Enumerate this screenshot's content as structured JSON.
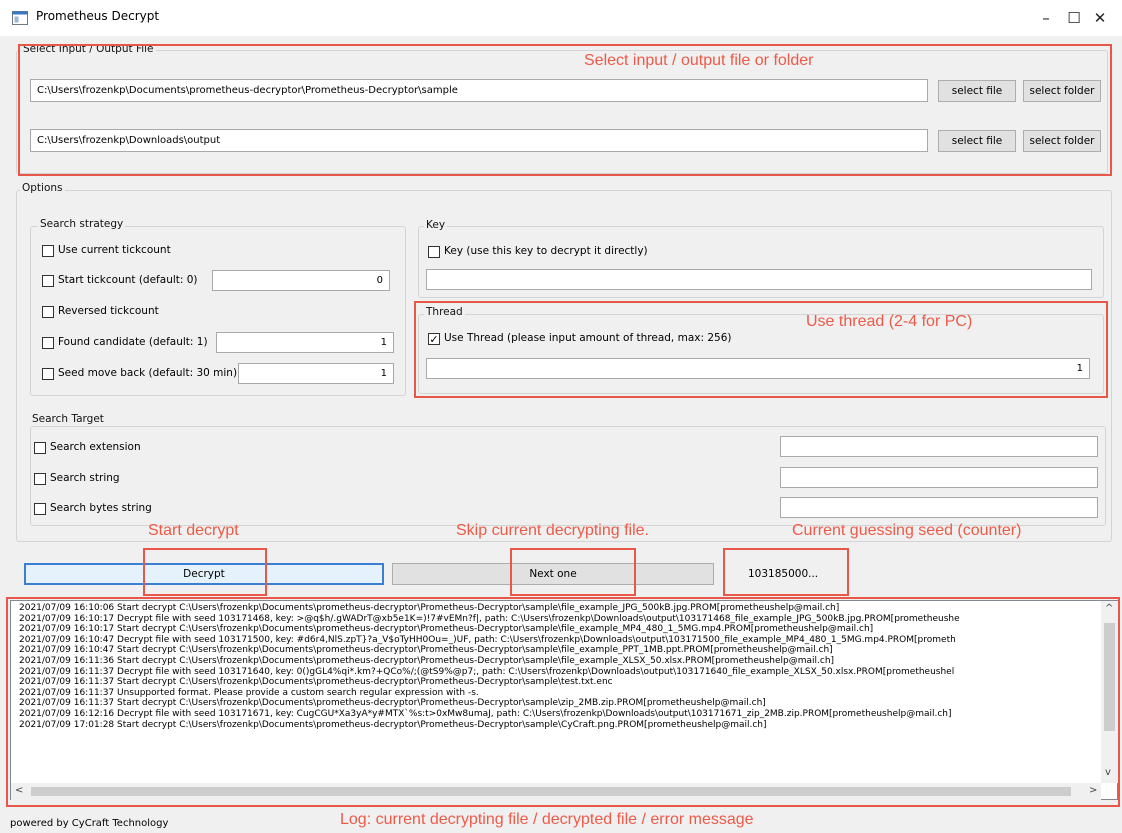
{
  "window": {
    "title": "Prometheus Decrypt",
    "minimize": "–",
    "maximize": "☐",
    "close": "✕"
  },
  "io": {
    "group_label": "Select Input / Output File",
    "input_path": "C:\\Users\\frozenkp\\Documents\\prometheus-decryptor\\Prometheus-Decryptor\\sample",
    "output_path": "C:\\Users\\frozenkp\\Downloads\\output",
    "select_file": "select file",
    "select_folder": "select folder"
  },
  "options": {
    "group_label": "Options",
    "strategy": {
      "label": "Search strategy",
      "use_current": "Use current tickcount",
      "start_tick": "Start tickcount (default: 0)",
      "start_tick_value": "0",
      "reversed": "Reversed tickcount",
      "found_candidate": "Found candidate (default: 1)",
      "found_candidate_value": "1",
      "seed_move": "Seed move back (default: 30 min)",
      "seed_move_value": "1"
    },
    "key": {
      "label": "Key",
      "use_key": "Key (use this key to decrypt it directly)",
      "key_value": ""
    },
    "thread": {
      "label": "Thread",
      "use_thread": "Use Thread (please input amount of thread, max: 256)",
      "checked": true,
      "check_glyph": "✓",
      "value": "1"
    },
    "target": {
      "label": "Search Target",
      "extension": "Search extension",
      "string": "Search string",
      "bytes": "Search bytes string"
    }
  },
  "actions": {
    "decrypt": "Decrypt",
    "next": "Next one",
    "seed_counter": "103185000..."
  },
  "log": {
    "lines": [
      "2021/07/09 16:10:06 Start decrypt C:\\Users\\frozenkp\\Documents\\prometheus-decryptor\\Prometheus-Decryptor\\sample\\file_example_JPG_500kB.jpg.PROM[prometheushelp@mail.ch]",
      "2021/07/09 16:10:17 Decrypt file with seed 103171468, key: >@q$h/.gWADrT@xb5e1K=)!7#vEMn?f|, path: C:\\Users\\frozenkp\\Downloads\\output\\103171468_file_example_JPG_500kB.jpg.PROM[prometheushe",
      "2021/07/09 16:10:17 Start decrypt C:\\Users\\frozenkp\\Documents\\prometheus-decryptor\\Prometheus-Decryptor\\sample\\file_example_MP4_480_1_5MG.mp4.PROM[prometheushelp@mail.ch]",
      "2021/07/09 16:10:47 Decrypt file with seed 103171500, key: #d6r4,NlS.zpT}?a_V$oTyHH0Ou=_)UF, path: C:\\Users\\frozenkp\\Downloads\\output\\103171500_file_example_MP4_480_1_5MG.mp4.PROM[prometh",
      "2021/07/09 16:10:47 Start decrypt C:\\Users\\frozenkp\\Documents\\prometheus-decryptor\\Prometheus-Decryptor\\sample\\file_example_PPT_1MB.ppt.PROM[prometheushelp@mail.ch]",
      "2021/07/09 16:11:36 Start decrypt C:\\Users\\frozenkp\\Documents\\prometheus-decryptor\\Prometheus-Decryptor\\sample\\file_example_XLSX_50.xlsx.PROM[prometheushelp@mail.ch]",
      "2021/07/09 16:11:37 Decrypt file with seed 103171640, key: 0()gGL4%qi*.km?+QCo%/;(@tS9%@p7;, path: C:\\Users\\frozenkp\\Downloads\\output\\103171640_file_example_XLSX_50.xlsx.PROM[prometheushel",
      "2021/07/09 16:11:37 Start decrypt C:\\Users\\frozenkp\\Documents\\prometheus-decryptor\\Prometheus-Decryptor\\sample\\test.txt.enc",
      "2021/07/09 16:11:37 Unsupported format. Please provide a custom search regular expression with -s.",
      "2021/07/09 16:11:37 Start decrypt C:\\Users\\frozenkp\\Documents\\prometheus-decryptor\\Prometheus-Decryptor\\sample\\zip_2MB.zip.PROM[prometheushelp@mail.ch]",
      "2021/07/09 16:12:16 Decrypt file with seed 103171671, key: CugCGU*Xa3yA*y#MTX`%s:t>0xMw8umaJ, path: C:\\Users\\frozenkp\\Downloads\\output\\103171671_zip_2MB.zip.PROM[prometheushelp@mail.ch]",
      "2021/07/09 17:01:28 Start decrypt C:\\Users\\frozenkp\\Documents\\prometheus-decryptor\\Prometheus-Decryptor\\sample\\CyCraft.png.PROM[prometheushelp@mail.ch]"
    ],
    "scroll_up": "^",
    "scroll_down": "v",
    "scroll_left": "<",
    "scroll_right": ">"
  },
  "footer": {
    "text": "powered by CyCraft Technology"
  },
  "annotations": {
    "io": "Select input / output file or folder",
    "thread": "Use thread (2-4 for PC)",
    "decrypt": "Start decrypt",
    "skip": "Skip current decrypting file.",
    "seed": "Current guessing seed (counter)",
    "log": "Log: current decrypting file / decrypted file / error message"
  },
  "colors": {
    "annotation": "#ee5a48",
    "decrypt_border": "#3c7fd1"
  }
}
